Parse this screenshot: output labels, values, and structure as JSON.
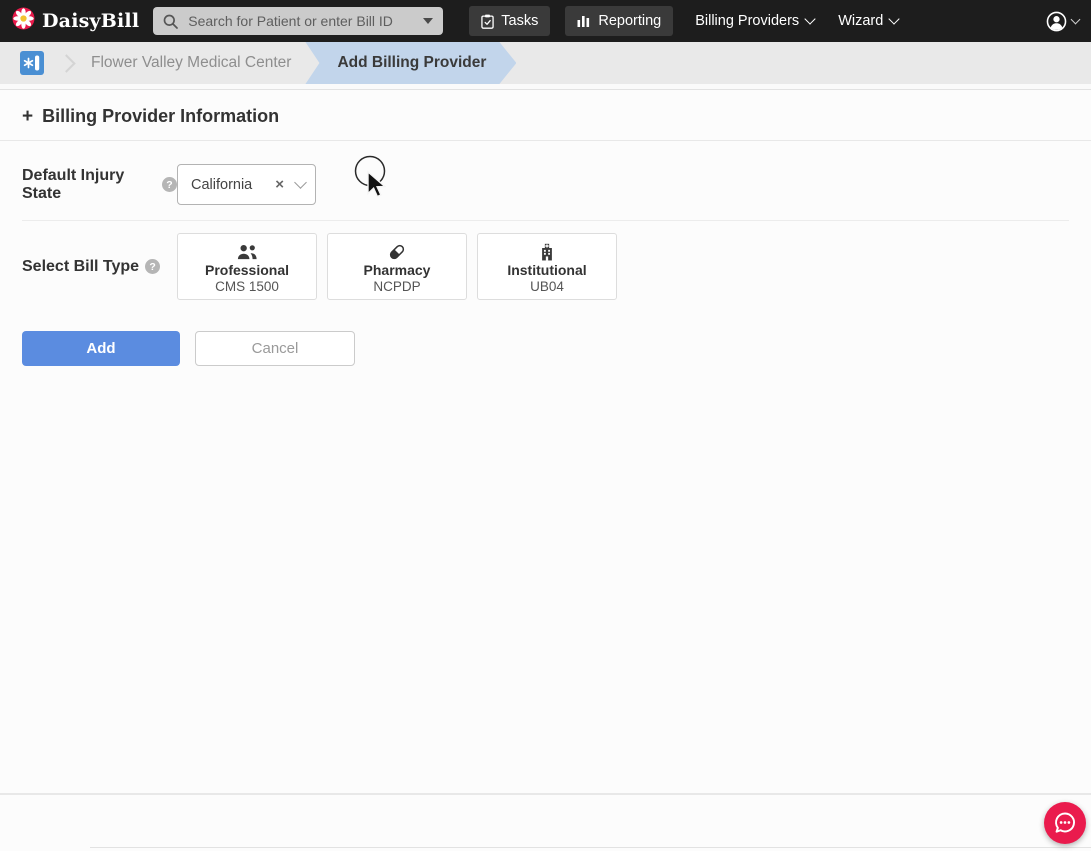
{
  "topnav": {
    "logo_text": "DaisyBill",
    "search_placeholder": "Search for Patient or enter Bill ID",
    "tasks_label": "Tasks",
    "reporting_label": "Reporting",
    "billing_providers_label": "Billing Providers",
    "wizard_label": "Wizard"
  },
  "breadcrumb": {
    "facility": "Flower Valley Medical Center",
    "current": "Add Billing Provider"
  },
  "main": {
    "section_title": "Billing Provider Information",
    "injury_state": {
      "label": "Default Injury State",
      "value": "California"
    },
    "bill_type": {
      "label": "Select Bill Type",
      "options": [
        {
          "title": "Professional",
          "subtitle": "CMS 1500",
          "icon": "people-icon"
        },
        {
          "title": "Pharmacy",
          "subtitle": "NCPDP",
          "icon": "pill-icon"
        },
        {
          "title": "Institutional",
          "subtitle": "UB04",
          "icon": "hospital-icon"
        }
      ]
    },
    "buttons": {
      "add": "Add",
      "cancel": "Cancel"
    }
  },
  "icons": {
    "plus": "+",
    "help": "?",
    "close": "×"
  },
  "colors": {
    "topnav_bg": "#1d1d1d",
    "nav_button_bg": "#3a3a3a",
    "breadcrumb_bg": "#e9e9e9",
    "breadcrumb_active_bg": "#c2d5eb",
    "accent_blue": "#5b8ce0",
    "chat_button": "#ea1b4d",
    "logo_flower": "#e8194a"
  }
}
